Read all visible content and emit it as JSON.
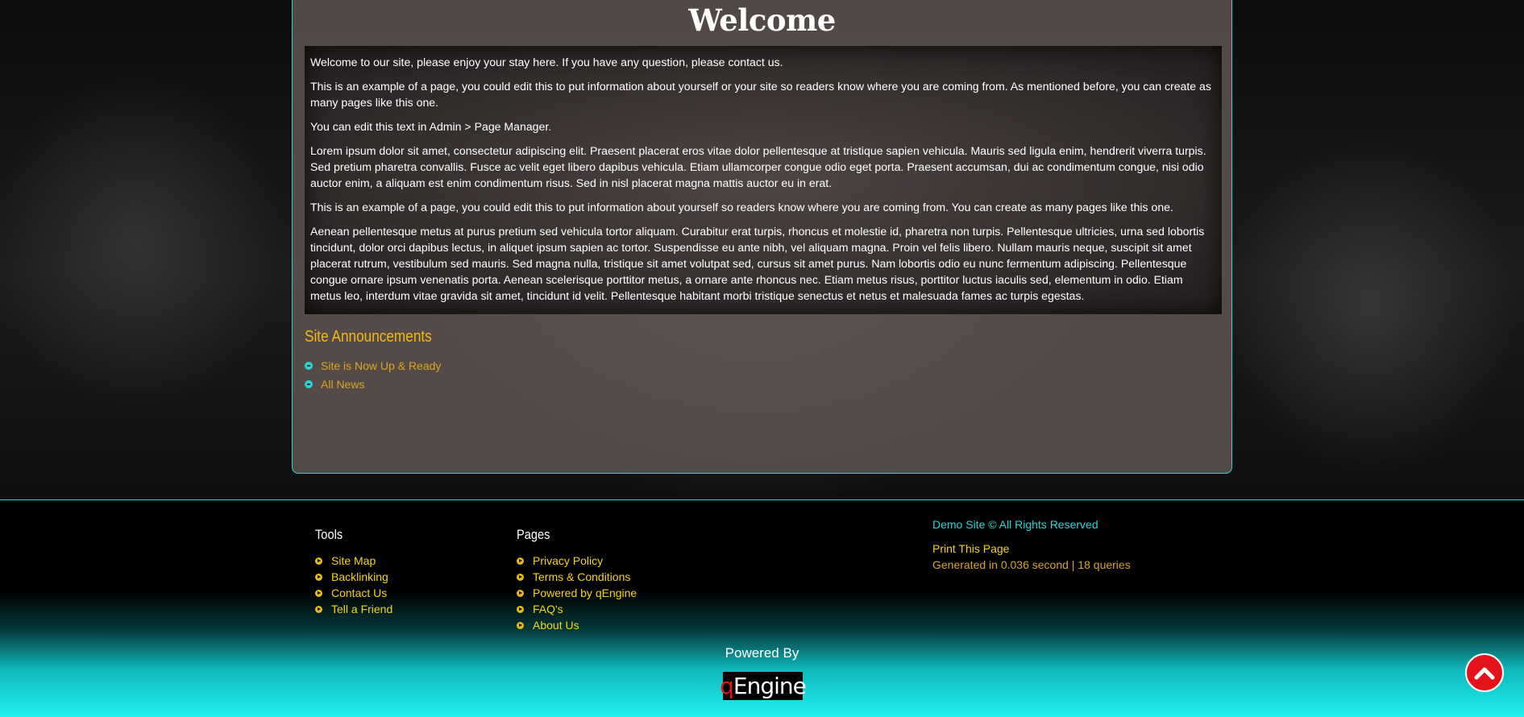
{
  "main": {
    "title": "Welcome",
    "paragraphs": [
      "Welcome to our site, please enjoy your stay here. If you have any question, please contact us.",
      "This is an example of a page, you could edit this to put information about yourself or your site so readers know where you are coming from. As mentioned before, you can create as many pages like this one.",
      "You can edit this text in Admin > Page Manager.",
      "Lorem ipsum dolor sit amet, consectetur adipiscing elit. Praesent placerat eros vitae dolor pellentesque at tristique sapien vehicula. Mauris sed ligula enim, hendrerit viverra turpis. Sed pretium pharetra convallis. Fusce ac velit eget libero dapibus vehicula. Etiam ullamcorper congue odio eget porta. Praesent accumsan, dui ac condimentum congue, nisi odio auctor enim, a aliquam est enim condimentum risus. Sed in nisl placerat magna mattis auctor eu in erat.",
      "This is an example of a page, you could edit this to put information about yourself so readers know where you are coming from. You can create as many pages like this one.",
      "Aenean pellentesque metus at purus pretium sed vehicula tortor aliquam. Curabitur erat turpis, rhoncus et molestie id, pharetra non turpis. Pellentesque ultricies, urna sed lobortis tincidunt, dolor orci dapibus lectus, in aliquet ipsum sapien ac tortor. Suspendisse eu ante nibh, vel aliquam magna. Proin vel felis libero. Nullam mauris neque, suscipit sit amet placerat rutrum, vestibulum sed mauris. Sed magna nulla, tristique sit amet volutpat sed, cursus sit amet purus. Nam lobortis odio eu nunc fermentum adipiscing. Pellentesque congue ornare ipsum venenatis porta. Aenean scelerisque porttitor metus, a ornare ante rhoncus nec. Etiam metus risus, porttitor luctus iaculis sed, elementum in odio. Etiam metus leo, interdum vitae gravida sit amet, tincidunt id velit. Pellentesque habitant morbi tristique senectus et netus et malesuada fames ac turpis egestas."
    ]
  },
  "announcements": {
    "title": "Site Announcements",
    "items": [
      "Site is Now Up & Ready",
      "All News"
    ]
  },
  "footer": {
    "tools": {
      "title": "Tools",
      "items": [
        "Site Map",
        "Backlinking",
        "Contact Us",
        "Tell a Friend"
      ]
    },
    "pages": {
      "title": "Pages",
      "items": [
        "Privacy Policy",
        "Terms & Conditions",
        "Powered by qEngine",
        "FAQ's",
        "About Us"
      ]
    },
    "copyright": "Demo Site © All Rights Reserved",
    "print": "Print This Page",
    "generated": "Generated in 0.036 second | 18 queries",
    "powered_by": "Powered By",
    "logo": {
      "q": "q",
      "rest": "Engine"
    }
  },
  "colors": {
    "accent_cyan": "#2ad4d4",
    "link_yellow": "#f2d515",
    "heading_gold": "#f0b81a",
    "scroll_button": "#e3121b"
  },
  "icons": {
    "scroll_top": "chevron-up-icon"
  }
}
